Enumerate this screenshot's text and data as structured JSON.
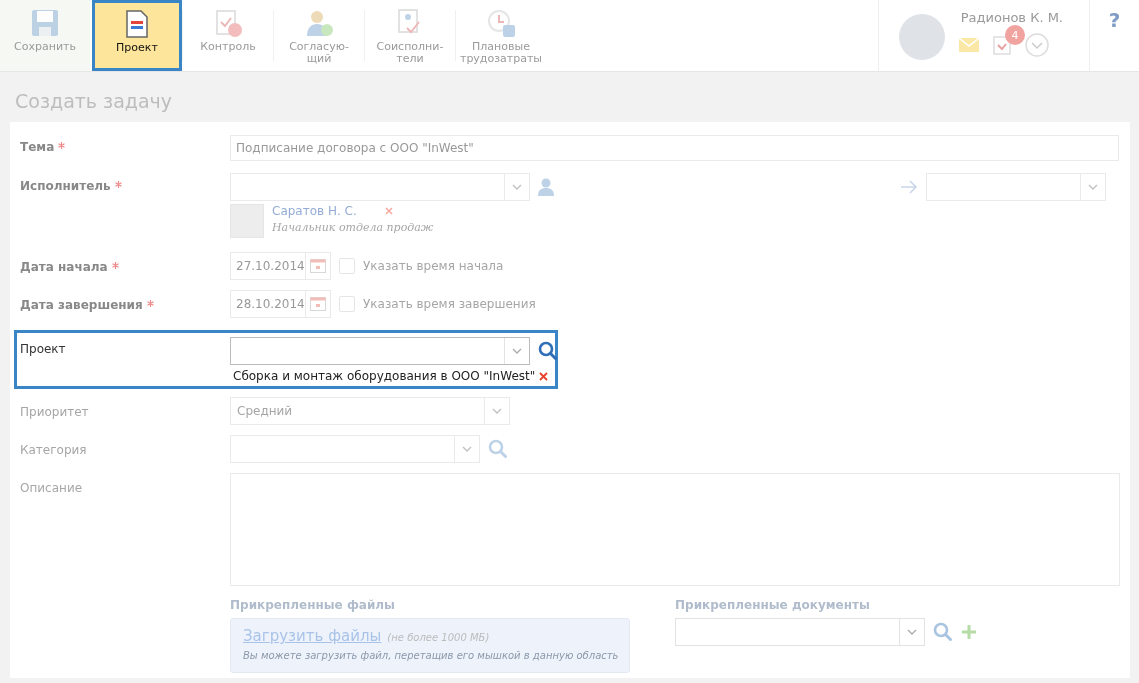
{
  "toolbar": {
    "buttons": [
      {
        "lines": [
          "Сохранить"
        ],
        "selected": false
      },
      {
        "lines": [
          "Проект"
        ],
        "selected": true
      },
      {
        "lines": [
          "Контроль"
        ],
        "selected": false
      },
      {
        "lines": [
          "Согласую-",
          "щий"
        ],
        "selected": false
      },
      {
        "lines": [
          "Соисполни-",
          "тели"
        ],
        "selected": false
      },
      {
        "lines": [
          "Плановые",
          "трудозатраты"
        ],
        "selected": false
      }
    ],
    "user": {
      "name": "Радионов К. М.",
      "tasks_badge": "4"
    },
    "help": "?"
  },
  "page_title": "Создать задачу",
  "form": {
    "rows": [
      {
        "kind": "text",
        "label": "Тема",
        "required": true,
        "highlighted": false,
        "value": "Подписание договора с ООО \"InWest\""
      },
      {
        "kind": "assignee",
        "label": "Исполнитель",
        "required": true,
        "highlighted": false,
        "person": {
          "name": "Саратов Н. С.",
          "position": "Начальник отдела продаж"
        }
      },
      {
        "kind": "date",
        "label": "Дата начала",
        "required": true,
        "highlighted": false,
        "value": "27.10.2014",
        "checkbox": {
          "label": "Указать время начала",
          "checked": false
        }
      },
      {
        "kind": "date",
        "label": "Дата завершения",
        "required": true,
        "highlighted": false,
        "value": "28.10.2014",
        "checkbox": {
          "label": "Указать время завершения",
          "checked": false
        }
      },
      {
        "kind": "project",
        "label": "Проект",
        "required": false,
        "highlighted": true,
        "chosen": "Сборка и монтаж оборудования в ООО \"InWest\""
      },
      {
        "kind": "select",
        "label": "Приоритет",
        "required": false,
        "highlighted": false,
        "value": "Средний",
        "search": false
      },
      {
        "kind": "select",
        "label": "Категория",
        "required": false,
        "highlighted": false,
        "value": "",
        "search": true
      },
      {
        "kind": "textarea",
        "label": "Описание",
        "required": false,
        "highlighted": false
      }
    ],
    "attachments": {
      "files_title": "Прикрепленные файлы",
      "upload_link": "Загрузить файлы",
      "upload_limit": "(не более 1000 МБ)",
      "upload_hint": "Вы можете загрузить файл, перетащив его мышкой в данную область",
      "documents_title": "Прикрепленные документы"
    }
  }
}
